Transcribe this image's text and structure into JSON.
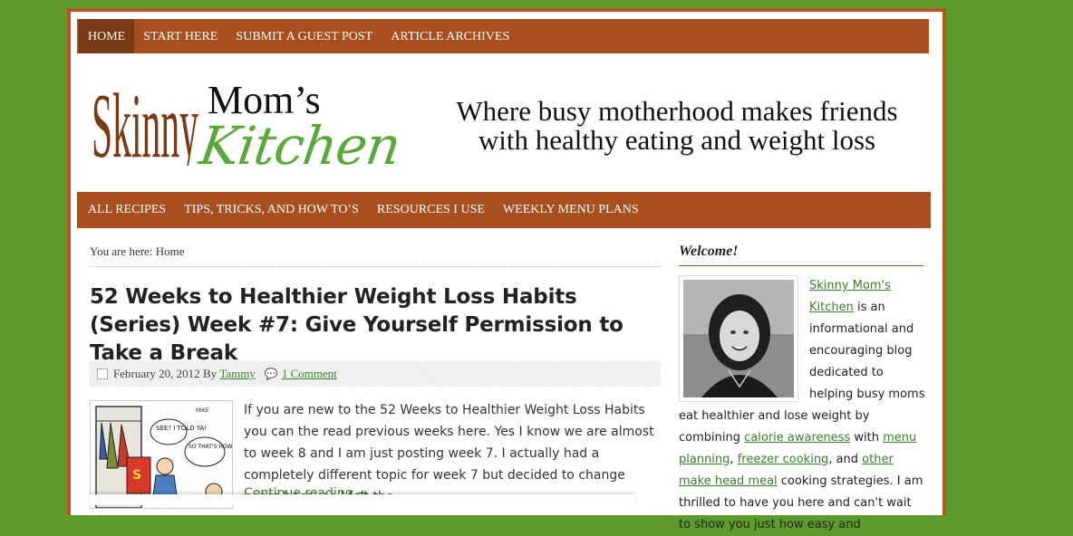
{
  "top_nav": {
    "items": [
      "HOME",
      "START HERE",
      "SUBMIT A GUEST POST",
      "ARTICLE ARCHIVES"
    ]
  },
  "header": {
    "logo_skinny": "Skinny",
    "logo_moms": "Mom’s",
    "logo_kitchen": "Kitchen",
    "tagline_line1": "Where busy motherhood makes friends",
    "tagline_line2": "with healthy eating and weight loss"
  },
  "sub_nav": {
    "items": [
      "ALL RECIPES",
      "TIPS, TRICKS, AND HOW TO’S",
      "RESOURCES I USE",
      "WEEKLY MENU PLANS"
    ]
  },
  "breadcrumb": {
    "prefix": "You are here: ",
    "current": "Home"
  },
  "post": {
    "title": "52 Weeks to Healthier Weight Loss Habits (Series) Week #7: Give Yourself Permission to Take a Break",
    "date": "February 20, 2012",
    "by": "By",
    "author": "Tammy",
    "comments": "1 Comment",
    "excerpt": "If you are new to the 52 Weeks to Healthier Weight Loss Habits you can the read previous weeks here. Yes I know we are almost to week 8 and I am just posting week 7. I actually had a completely different topic for week 7 but decided to change gears because I felt the",
    "continue": "Continue reading →",
    "thumb_bubble1": "SEE? I TOLD YA!",
    "thumb_bubble2": "SO THAT'S HOW SHE DOES IT..."
  },
  "sidebar": {
    "widget_title": "Welcome!",
    "link_site": "Skinny Mom's Kitchen",
    "text1": " is an informational and encouraging blog dedicated to helping busy moms eat healthier and lose weight by combining ",
    "link_calorie": "calorie awareness",
    "text2": " with ",
    "link_menu": "menu planning",
    "text3": ", ",
    "link_freezer": "freezer cooking",
    "text4": ", and ",
    "link_other": "other make head meal",
    "text5": " cooking strategies. I am thrilled to have you here and can't wait to show you just how easy and"
  }
}
